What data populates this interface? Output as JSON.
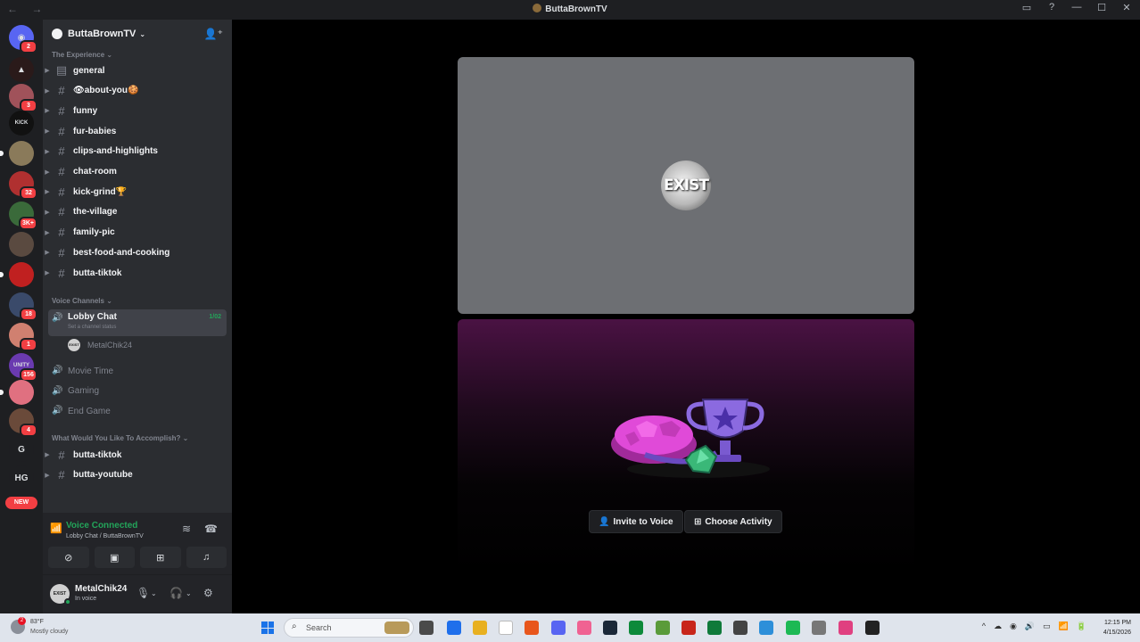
{
  "window": {
    "title": "ButtaBrownTV",
    "nav_arrows": "← →",
    "controls": [
      "inbox-icon",
      "help-icon",
      "minimize-icon",
      "maximize-icon",
      "close-icon"
    ]
  },
  "rail": {
    "servers": [
      {
        "name": "home",
        "glyph": "◉",
        "badge": "2",
        "color": "#5865f2"
      },
      {
        "name": "apex",
        "glyph": "▲",
        "badge": "",
        "color": "#2a1a1a"
      },
      {
        "name": "server-pink",
        "glyph": "",
        "badge": "3",
        "color": "#a0525a"
      },
      {
        "name": "kick",
        "glyph": "KICK",
        "badge": "",
        "color": "#111111"
      },
      {
        "name": "server-group",
        "glyph": "",
        "badge": "",
        "color": "#8a7a5a"
      },
      {
        "name": "server-red",
        "glyph": "",
        "badge": "32",
        "color": "#b03030"
      },
      {
        "name": "server-green",
        "glyph": "",
        "badge": "3K+",
        "color": "#3a6a3a"
      },
      {
        "name": "server-person",
        "glyph": "",
        "badge": "",
        "color": "#5a4a40"
      },
      {
        "name": "server-shoe",
        "glyph": "",
        "badge": "",
        "color": "#c02020"
      },
      {
        "name": "server-blue",
        "glyph": "",
        "badge": "18",
        "color": "#3a4a6a"
      },
      {
        "name": "server-face",
        "glyph": "",
        "badge": "1",
        "color": "#d08070"
      },
      {
        "name": "server-unity",
        "glyph": "UNITY",
        "badge": "156",
        "color": "#6a3ab0"
      },
      {
        "name": "server-lips",
        "glyph": "",
        "badge": "",
        "color": "#e07080"
      },
      {
        "name": "server-man",
        "glyph": "",
        "badge": "4",
        "color": "#6a4a3a"
      },
      {
        "name": "server-g",
        "glyph": "G",
        "badge": "",
        "color": "#1e1f22"
      },
      {
        "name": "server-hg",
        "glyph": "HG",
        "badge": "",
        "color": "#1e1f22"
      }
    ],
    "new_label": "NEW"
  },
  "sidebar": {
    "server_name": "ButtaBrownTV",
    "categories": {
      "experience": "The Experience",
      "voice": "Voice Channels",
      "accomplish": "What Would You Like To Accomplish?"
    },
    "text_channels": [
      {
        "name": "general",
        "muted": false
      },
      {
        "name": "👁about-you🍪",
        "muted": false
      },
      {
        "name": "funny",
        "muted": false
      },
      {
        "name": "fur-babies",
        "muted": false
      },
      {
        "name": "clips-and-highlights",
        "muted": false
      },
      {
        "name": "chat-room",
        "muted": false
      },
      {
        "name": "kick-grind🏆",
        "muted": false
      },
      {
        "name": "the-village",
        "muted": false
      },
      {
        "name": "family-pic",
        "muted": false
      },
      {
        "name": "best-food-and-cooking",
        "muted": false
      },
      {
        "name": "butta-tiktok",
        "muted": false
      }
    ],
    "lobby": {
      "name": "Lobby Chat",
      "status_placeholder": "Set a channel status",
      "count": "1/02",
      "user": "MetalChik24"
    },
    "voice_channels": [
      "Movie Time",
      "Gaming",
      "End Game"
    ],
    "bottom_channels": [
      "butta-tiktok",
      "butta-youtube"
    ],
    "voice_panel": {
      "title": "Voice Connected",
      "subtitle": "Lobby Chat / ButtaBrownTV"
    },
    "user_panel": {
      "name": "MetalChik24",
      "status": "In voice",
      "avatar_text": "EXIST"
    }
  },
  "main": {
    "avatar_text": "EXIST",
    "invite_label": "Invite to Voice",
    "activity_label": "Choose Activity"
  },
  "taskbar": {
    "weather_temp": "83°F",
    "weather_desc": "Mostly cloudy",
    "weather_badge": "2",
    "search_placeholder": "Search",
    "time": "12:15 PM",
    "date": "4/15/2026",
    "app_colors": [
      "#4a4a4a",
      "#1f6feb",
      "#e8b020",
      "#ffffff",
      "#e8561c",
      "#5865f2",
      "#f06292",
      "#1b2838",
      "#0d8a3a",
      "#5a9b3a",
      "#c8261a",
      "#0f7a3a",
      "#444444",
      "#2d8fd9",
      "#1db954",
      "#777777",
      "#e04080",
      "#222222"
    ],
    "tray": [
      "^",
      "☁",
      "◉",
      "🔊",
      "▭",
      "📶",
      "🔋"
    ]
  }
}
